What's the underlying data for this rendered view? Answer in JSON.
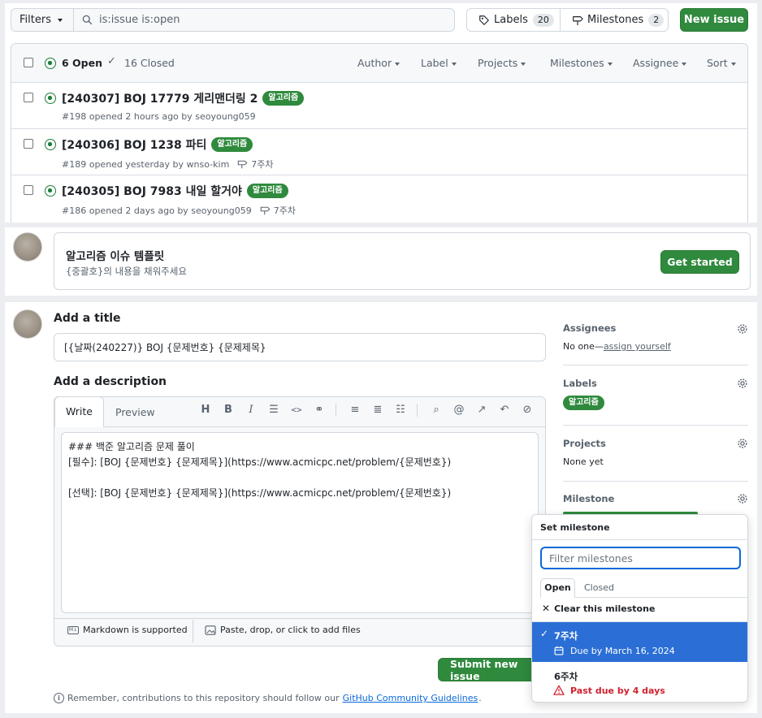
{
  "topbar": {
    "filters_label": "Filters",
    "search_value": "is:issue is:open",
    "labels_label": "Labels",
    "labels_count": "20",
    "milestones_label": "Milestones",
    "milestones_count": "2",
    "new_issue_label": "New issue"
  },
  "list_header": {
    "open_label": "6 Open",
    "closed_label": "16 Closed",
    "filters": [
      "Author",
      "Label",
      "Projects",
      "Milestones",
      "Assignee",
      "Sort"
    ]
  },
  "issues": [
    {
      "title": "[240307] BOJ 17779 게리맨더링 2",
      "label": "알고리즘",
      "meta": "#198 opened 2 hours ago by seoyoung059",
      "milestone": ""
    },
    {
      "title": "[240306] BOJ 1238 파티",
      "label": "알고리즘",
      "meta": "#189 opened yesterday by wnso-kim",
      "milestone": "7주차"
    },
    {
      "title": "[240305] BOJ 7983 내일 할거야",
      "label": "알고리즘",
      "meta": "#186 opened 2 days ago by seoyoung059",
      "milestone": "7주차"
    }
  ],
  "template": {
    "title": "알고리즘 이슈 템플릿",
    "subtitle": "{중괄호}의 내용을 채워주세요",
    "button": "Get started"
  },
  "form": {
    "title_heading": "Add a title",
    "title_value": "[{날짜(240227)} BOJ {문제번호} {문제제목}",
    "desc_heading": "Add a description",
    "tab_write": "Write",
    "tab_preview": "Preview",
    "body_lines": [
      "### 백준 알고리즘 문제 풀이",
      "[필수]: [BOJ {문제번호} {문제제목}](https://www.acmicpc.net/problem/{문제번호})",
      "",
      "[선택]: [BOJ {문제번호} {문제제목}](https://www.acmicpc.net/problem/{문제번호})"
    ],
    "markdown_note": "Markdown is supported",
    "paste_note": "Paste, drop, or click to add files",
    "submit": "Submit new issue",
    "footer_prefix": "Remember, contributions to this repository should follow our",
    "footer_link": "GitHub Community Guidelines",
    "footer_suffix": "."
  },
  "sidebar": {
    "assignees_heading": "Assignees",
    "assignees_value": "No one—",
    "assign_yourself": "assign yourself",
    "labels_heading": "Labels",
    "label_value": "알고리즘",
    "projects_heading": "Projects",
    "projects_value": "None yet",
    "milestone_heading": "Milestone"
  },
  "milestone_popup": {
    "heading": "Set milestone",
    "filter_placeholder": "Filter milestones",
    "tab_open": "Open",
    "tab_closed": "Closed",
    "clear": "Clear this milestone",
    "items": [
      {
        "name": "7주차",
        "due": "Due by March 16, 2024",
        "selected": true
      },
      {
        "name": "6주차",
        "due": "Past due by 4 days",
        "selected": false
      }
    ]
  },
  "colors": {
    "accent_green": "#2f8a3d",
    "selected_blue": "#2b6fd6",
    "danger_red": "#cf222e"
  }
}
